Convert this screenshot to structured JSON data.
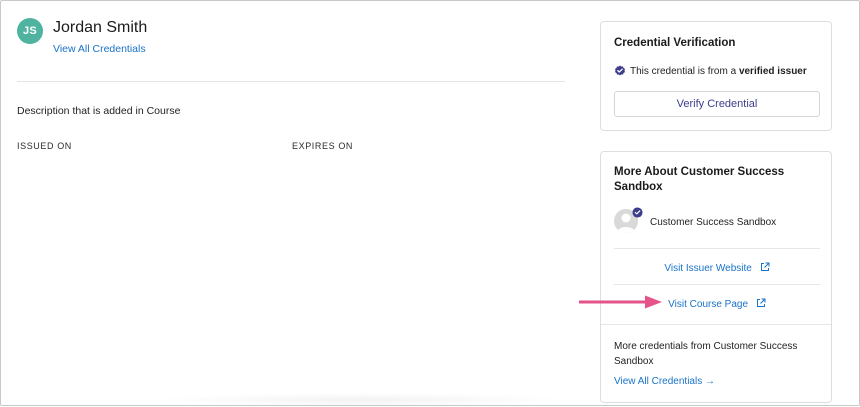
{
  "profile": {
    "initials": "JS",
    "name": "Jordan Smith",
    "view_all_label": "View All Credentials"
  },
  "credential": {
    "description": "Description that is added in Course",
    "issued_on_label": "ISSUED ON",
    "expires_on_label": "EXPIRES ON"
  },
  "verification": {
    "title": "Credential Verification",
    "verified_prefix": "This credential is from a ",
    "verified_bold": "verified issuer",
    "verify_button": "Verify Credential"
  },
  "more_about": {
    "title": "More About Customer Success Sandbox",
    "issuer_name": "Customer Success Sandbox",
    "visit_issuer": "Visit Issuer Website",
    "visit_course": "Visit Course Page",
    "more_credentials_text": "More credentials from Customer Success Sandbox",
    "view_all_label": "View All Credentials →"
  },
  "colors": {
    "avatar_bg": "#4fb3a0",
    "link": "#1a73c8",
    "verified_badge": "#3d3d8a",
    "arrow": "#e6538a"
  }
}
